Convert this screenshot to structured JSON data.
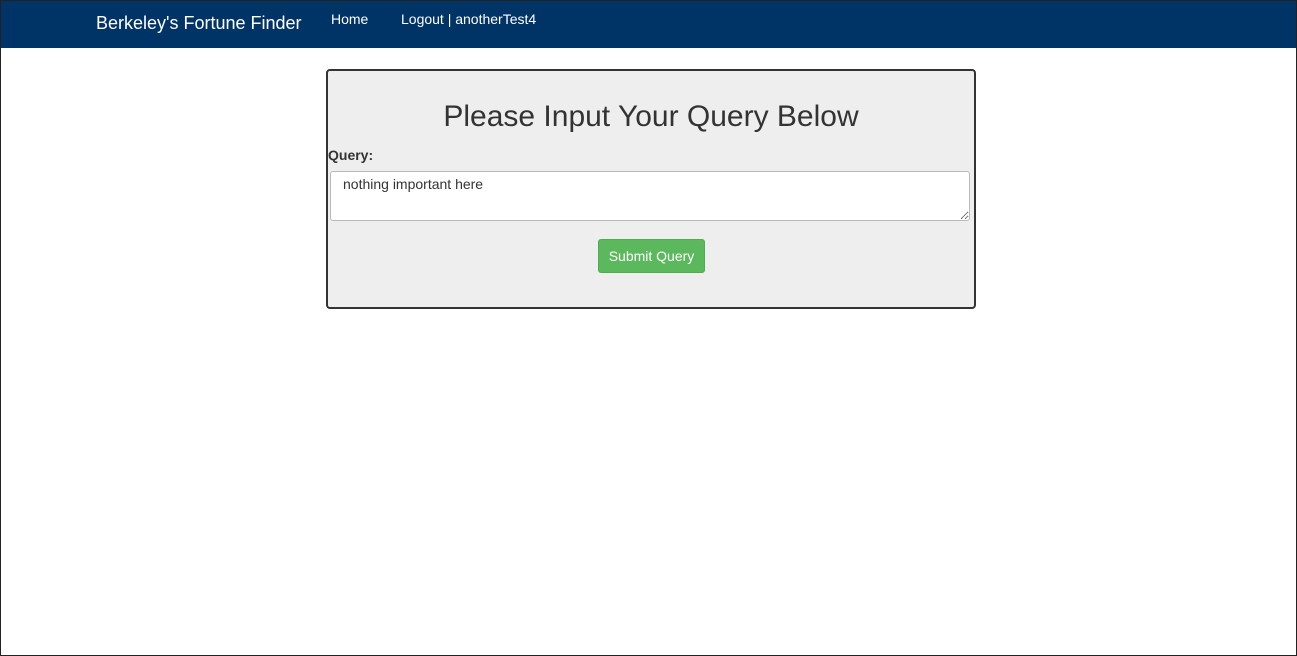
{
  "navbar": {
    "brand": "Berkeley's Fortune Finder",
    "links": [
      {
        "label": "Home"
      },
      {
        "label": "Logout | anotherTest4"
      }
    ],
    "bg_color": "#003366"
  },
  "form": {
    "title": "Please Input Your Query Below",
    "query_label": "Query:",
    "query_value": "nothing important here",
    "submit_label": "Submit Query",
    "submit_color": "#5cb85c"
  }
}
